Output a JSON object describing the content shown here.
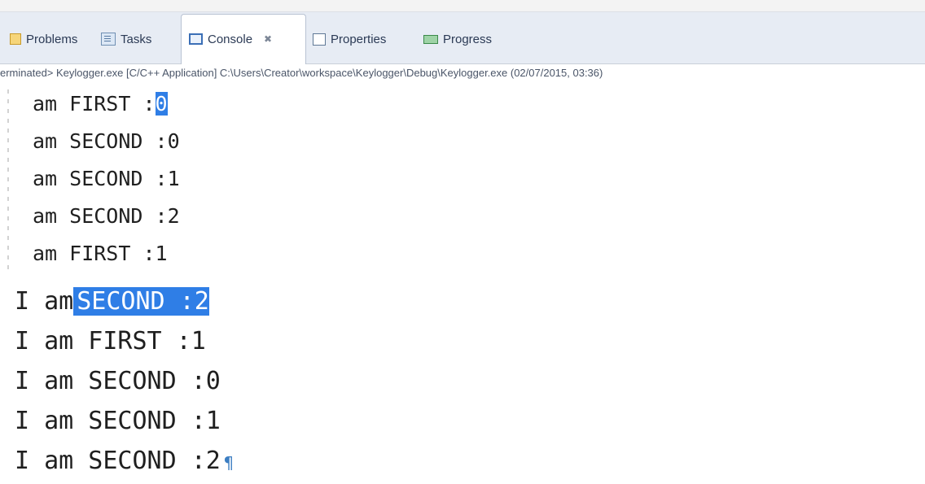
{
  "tabs": {
    "problems": "Problems",
    "tasks": "Tasks",
    "console": "Console",
    "console_close": "✖",
    "properties": "Properties",
    "progress": "Progress"
  },
  "status": "erminated> Keylogger.exe [C/C++ Application] C:\\Users\\Creator\\workspace\\Keylogger\\Debug\\Keylogger.exe (02/07/2015, 03:36)",
  "upper_console": {
    "line1_prefix": "am FIRST :",
    "line1_caret": "0",
    "lines": [
      "am SECOND :0",
      "am SECOND :1",
      "am SECOND :2",
      "am FIRST :1"
    ]
  },
  "lower_console": {
    "line1_prefix": "I am",
    "line1_selected": "SECOND :2",
    "lines": [
      "I am FIRST :1",
      "I am SECOND :0",
      "I am SECOND :1",
      "I am SECOND :2"
    ],
    "end_mark": "¶"
  },
  "colors": {
    "selection": "#2f7ee6",
    "tabbar": "#e7ecf4"
  }
}
